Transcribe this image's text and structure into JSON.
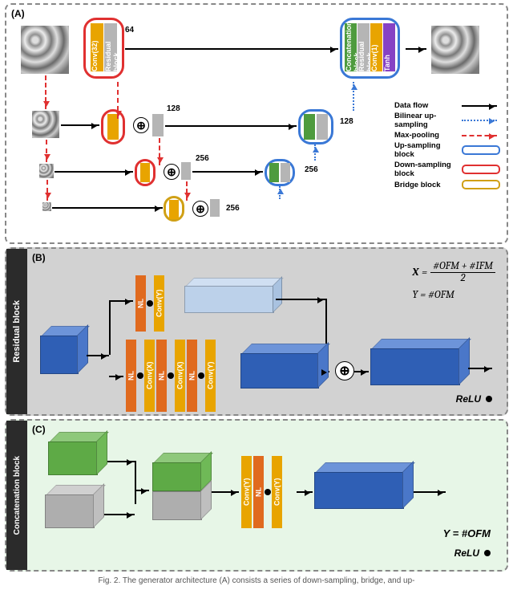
{
  "caption": "Fig. 2. The generator architecture (A) consists a series of down-sampling, bridge, and up-",
  "panelA": {
    "letter": "(A)",
    "blocks": {
      "enc0": {
        "conv": "Conv(32)",
        "res": "Residual block"
      },
      "dec0": {
        "concat": "Concatenation block",
        "res": "Residual block",
        "conv": "Conv(1)",
        "act": "Tanh"
      }
    },
    "numbers": {
      "l0": "64",
      "l1": "128",
      "l2": "256",
      "l3": "256",
      "r1": "128",
      "r2": "256"
    },
    "legend": [
      {
        "label": "Data flow",
        "style": "solid-black"
      },
      {
        "label": "Bilinear up-sampling",
        "style": "dotted-blue"
      },
      {
        "label": "Max-pooling",
        "style": "dashed-red"
      },
      {
        "label": "Up-sampling block",
        "style": "box-blue"
      },
      {
        "label": "Down-sampling block",
        "style": "box-red"
      },
      {
        "label": "Bridge block",
        "style": "box-gold"
      }
    ]
  },
  "panelB": {
    "letter": "(B)",
    "title": "Residual block",
    "layers_top": [
      "NL",
      "Conv(Y)"
    ],
    "layers_bottom": [
      "NL",
      "Conv(X)",
      "NL",
      "Conv(X)",
      "NL",
      "Conv(Y)"
    ],
    "eq1": "X = (#OFM + #IFM) / 2",
    "eq2": "Y = #OFM",
    "relu": "ReLU"
  },
  "panelC": {
    "letter": "(C)",
    "title": "Concatenation block",
    "layers": [
      "Conv(Y)",
      "NL",
      "Conv(Y)"
    ],
    "eq": "Y = #OFM",
    "relu": "ReLU"
  }
}
